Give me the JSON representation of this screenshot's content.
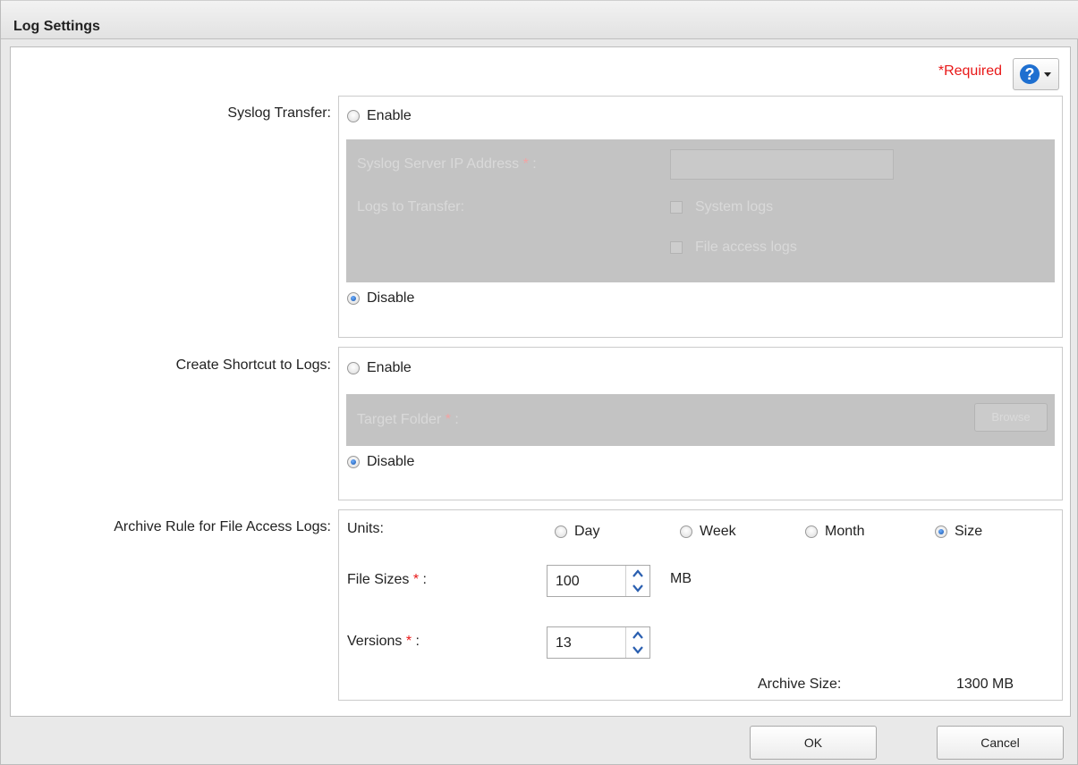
{
  "dialog": {
    "title": "Log Settings",
    "required_label": "*Required",
    "help_icon": "help-question-icon"
  },
  "syslog": {
    "label": "Syslog Transfer:",
    "enable_label": "Enable",
    "disable_label": "Disable",
    "selected": "Disable",
    "server_ip_label": "Syslog Server IP Address",
    "server_ip_value": "",
    "logs_label": "Logs to Transfer:",
    "system_logs_label": "System logs",
    "file_access_logs_label": "File access logs",
    "asterisk": "*",
    "colon": ":"
  },
  "shortcut": {
    "label": "Create Shortcut to Logs:",
    "enable_label": "Enable",
    "disable_label": "Disable",
    "selected": "Disable",
    "target_folder_label": "Target Folder",
    "browse_label": "Browse",
    "asterisk": "*",
    "colon": ":"
  },
  "archive": {
    "label": "Archive Rule for File Access Logs:",
    "units_label": "Units:",
    "units": [
      "Day",
      "Week",
      "Month",
      "Size"
    ],
    "selected_unit": "Size",
    "file_sizes_label": "File Sizes",
    "file_sizes_value": "100",
    "file_sizes_unit": "MB",
    "versions_label": "Versions",
    "versions_value": "13",
    "archive_size_label": "Archive Size:",
    "archive_size_value": "1300 MB",
    "asterisk": "*",
    "colon": ":"
  },
  "footer": {
    "ok_label": "OK",
    "cancel_label": "Cancel"
  },
  "colors": {
    "required": "#e81818",
    "help_blue": "#1e6fd0",
    "disabled_panel": "#c3c3c3"
  }
}
